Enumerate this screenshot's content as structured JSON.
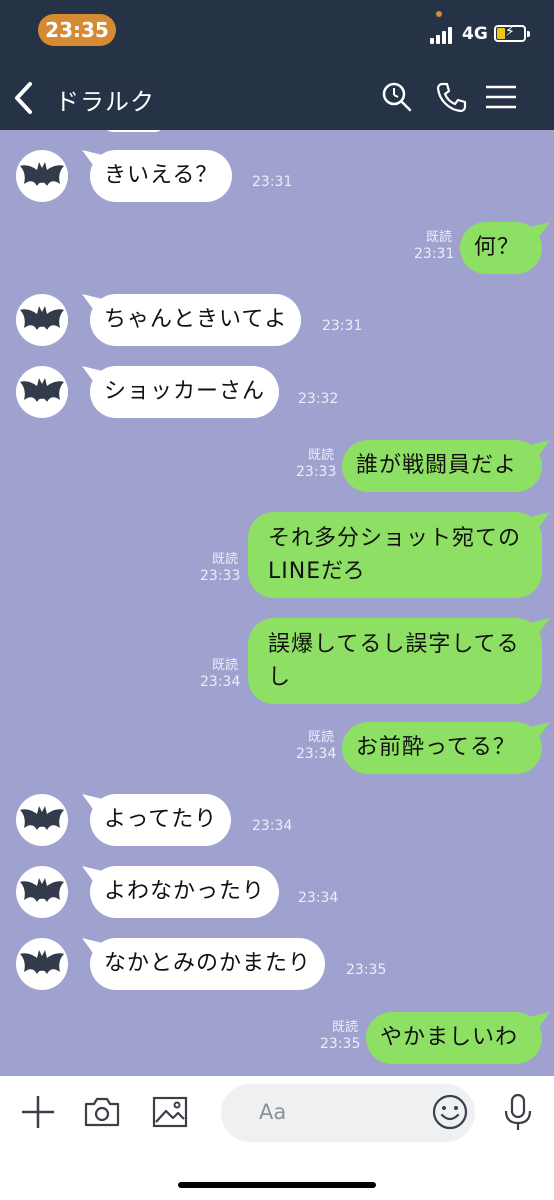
{
  "status_bar": {
    "time": "23:35",
    "network": "4G"
  },
  "header": {
    "title": "ドラルク",
    "bg_color": "#263246",
    "icons": [
      "back-icon",
      "search-icon",
      "phone-icon",
      "menu-icon"
    ]
  },
  "chat_bg_color": "#9fa1cf",
  "messages": [
    {
      "side": "in",
      "text": "きいえる？",
      "time": "23:31"
    },
    {
      "side": "out",
      "text": "何？",
      "time": "23:31",
      "read": "既読"
    },
    {
      "side": "in",
      "text": "ちゃんときいてよ",
      "time": "23:31"
    },
    {
      "side": "in",
      "text": "ショッカーさん",
      "time": "23:32"
    },
    {
      "side": "out",
      "text": "誰が戦闘員だよ",
      "time": "23:33",
      "read": "既読"
    },
    {
      "side": "out",
      "text": "それ多分ショット宛てのLINEだろ",
      "time": "23:33",
      "read": "既読"
    },
    {
      "side": "out",
      "text": "誤爆してるし誤字してるし",
      "time": "23:34",
      "read": "既読"
    },
    {
      "side": "out",
      "text": "お前酔ってる？",
      "time": "23:34",
      "read": "既読"
    },
    {
      "side": "in",
      "text": "よってたり",
      "time": "23:34"
    },
    {
      "side": "in",
      "text": "よわなかったり",
      "time": "23:34"
    },
    {
      "side": "in",
      "text": "なかとみのかまたり",
      "time": "23:35"
    },
    {
      "side": "out",
      "text": "やかましいわ",
      "time": "23:35",
      "read": "既読"
    }
  ],
  "input": {
    "placeholder": "Aa",
    "icons": [
      "plus-icon",
      "camera-icon",
      "image-icon",
      "emoji-icon",
      "mic-icon"
    ]
  },
  "colors": {
    "out_bubble": "#8ee064",
    "in_bubble": "#ffffff",
    "accent_time": "#d58a33"
  }
}
